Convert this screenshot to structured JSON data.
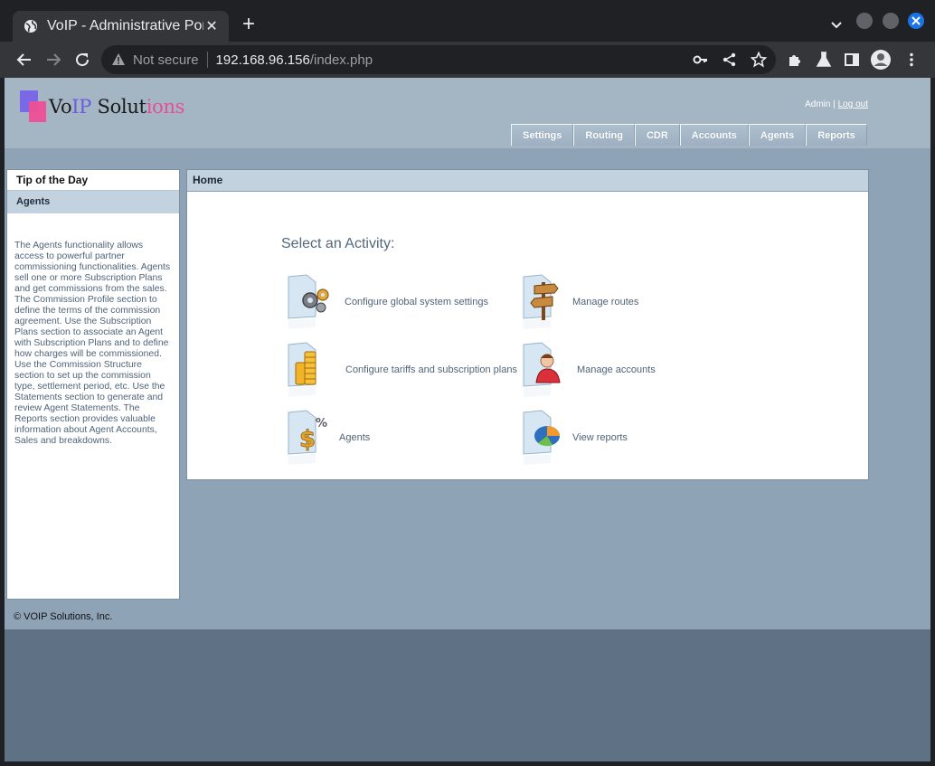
{
  "browser": {
    "tab_title": "VoIP - Administrative Portal",
    "not_secure": "Not secure",
    "url_host": "192.168.96.156",
    "url_path": "/index.php"
  },
  "site": {
    "logo": {
      "vo": "Vo",
      "ip": "IP",
      "solut": " Solut",
      "ions": "ions"
    },
    "user_name": "Admin",
    "user_sep": " | ",
    "logout": "Log out",
    "nav": [
      "Settings",
      "Routing",
      "CDR",
      "Accounts",
      "Agents",
      "Reports"
    ]
  },
  "sidebar": {
    "title": "Tip of the Day",
    "subtitle": "Agents",
    "text": "The Agents functionality allows access to powerful partner commissioning functionalities. Agents sell one or more Subscription Plans and get commissions from the sales. The Commission Profile section to define the terms of the commission agreement. Use the Subscription Plans section to associate an Agent with Subscription Plans and to define how charges will be commissioned. Use the Commission Structure section to set up the commission type, settlement period, etc. Use the Statements section to generate and review Agent Statements. The Reports section provides valuable information about Agent Accounts, Sales and breakdowns."
  },
  "main": {
    "title": "Home",
    "heading": "Select an Activity:",
    "activities": [
      {
        "label": "Configure global system settings",
        "icon": "gears-icon"
      },
      {
        "label": "Manage routes",
        "icon": "signpost-icon"
      },
      {
        "label": "Configure tariffs and subscription plans",
        "icon": "coins-icon"
      },
      {
        "label": "Manage accounts",
        "icon": "user-icon"
      },
      {
        "label": "Agents",
        "icon": "dollar-percent-icon"
      },
      {
        "label": "View reports",
        "icon": "pie-chart-icon"
      }
    ]
  },
  "footer": "© VOIP Solutions, Inc."
}
